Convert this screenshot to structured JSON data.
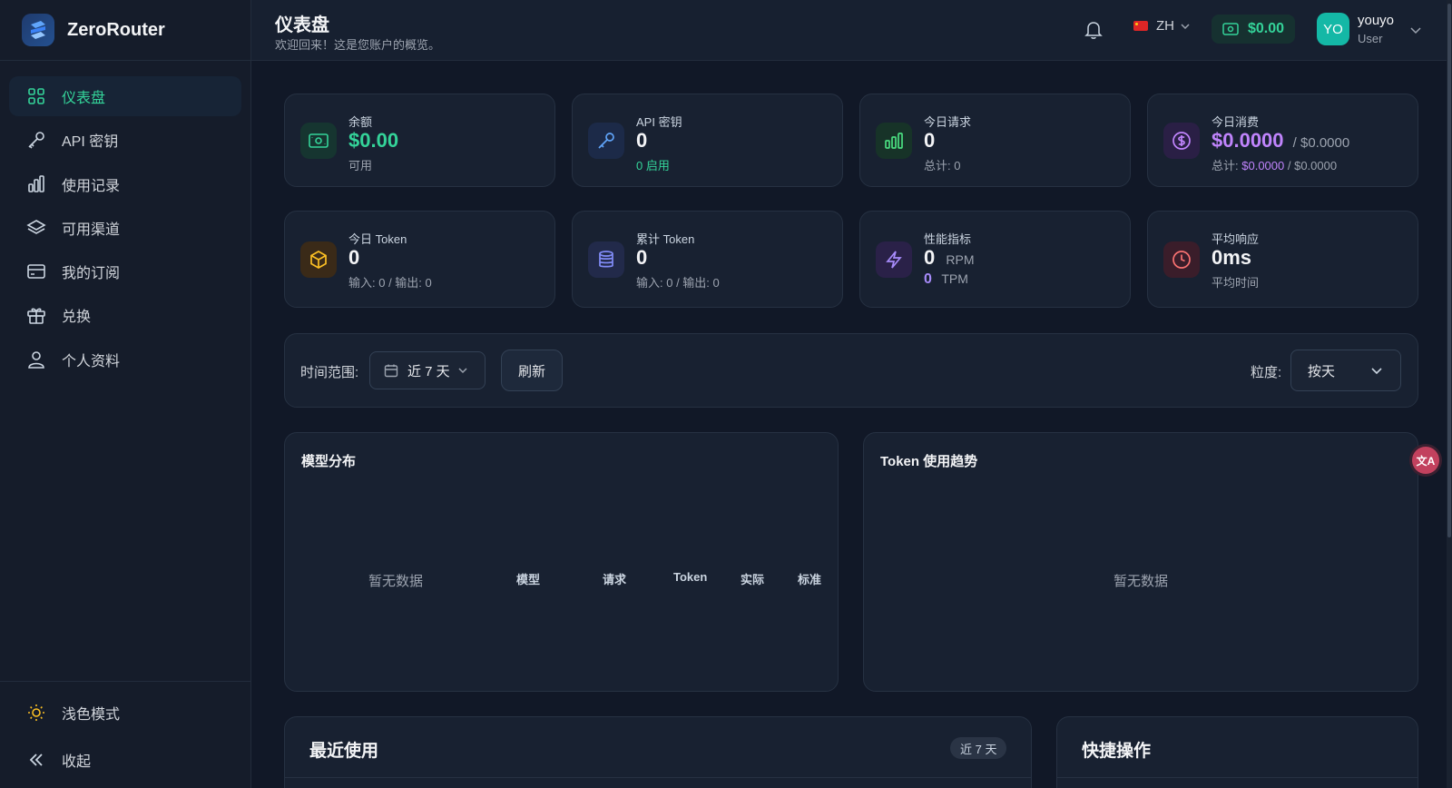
{
  "app": {
    "name": "ZeroRouter"
  },
  "sidebar": {
    "items": [
      {
        "label": "仪表盘",
        "icon": "dashboard-grid-icon",
        "active": true
      },
      {
        "label": "API 密钥",
        "icon": "key-icon"
      },
      {
        "label": "使用记录",
        "icon": "bar-chart-icon"
      },
      {
        "label": "可用渠道",
        "icon": "layers-icon"
      },
      {
        "label": "我的订阅",
        "icon": "credit-card-icon"
      },
      {
        "label": "兑换",
        "icon": "gift-icon"
      },
      {
        "label": "个人资料",
        "icon": "user-icon"
      }
    ],
    "theme_label": "浅色模式",
    "collapse_label": "收起"
  },
  "header": {
    "title": "仪表盘",
    "subtitle": "欢迎回来！这是您账户的概览。",
    "language": "ZH",
    "balance": "$0.00",
    "user": {
      "initials": "YO",
      "name": "youyo",
      "role": "User"
    }
  },
  "stats": {
    "balance": {
      "label": "余额",
      "value": "$0.00",
      "sub": "可用"
    },
    "api_keys": {
      "label": "API 密钥",
      "value": "0",
      "sub": "0 启用"
    },
    "today_requests": {
      "label": "今日请求",
      "value": "0",
      "sub": "总计: 0"
    },
    "today_cost": {
      "label": "今日消费",
      "value": "$0.0000",
      "value_std": "/ $0.0000",
      "sub_prefix": "总计:",
      "sub_actual": "$0.0000",
      "sub_std": "/ $0.0000"
    },
    "today_tokens": {
      "label": "今日 Token",
      "value": "0",
      "sub": "输入: 0 / 输出: 0"
    },
    "total_tokens": {
      "label": "累计 Token",
      "value": "0",
      "sub": "输入: 0 / 输出: 0"
    },
    "performance": {
      "label": "性能指标",
      "rpm_value": "0",
      "rpm_unit": "RPM",
      "tpm_value": "0",
      "tpm_unit": "TPM"
    },
    "avg_response": {
      "label": "平均响应",
      "value": "0ms",
      "sub": "平均时间"
    }
  },
  "filters": {
    "range_label": "时间范围:",
    "range_value": "近 7 天",
    "refresh_label": "刷新",
    "granularity_label": "粒度:",
    "granularity_value": "按天"
  },
  "model_distribution": {
    "title": "模型分布",
    "empty": "暂无数据",
    "columns": [
      "模型",
      "请求",
      "Token",
      "实际",
      "标准"
    ]
  },
  "token_trend": {
    "title": "Token 使用趋势",
    "empty": "暂无数据"
  },
  "recent": {
    "title": "最近使用",
    "badge": "近 7 天"
  },
  "quick_actions": {
    "title": "快捷操作"
  },
  "colors": {
    "accent": "#34d399",
    "purple": "#c084fc",
    "bg": "#111827",
    "card": "#182131"
  }
}
